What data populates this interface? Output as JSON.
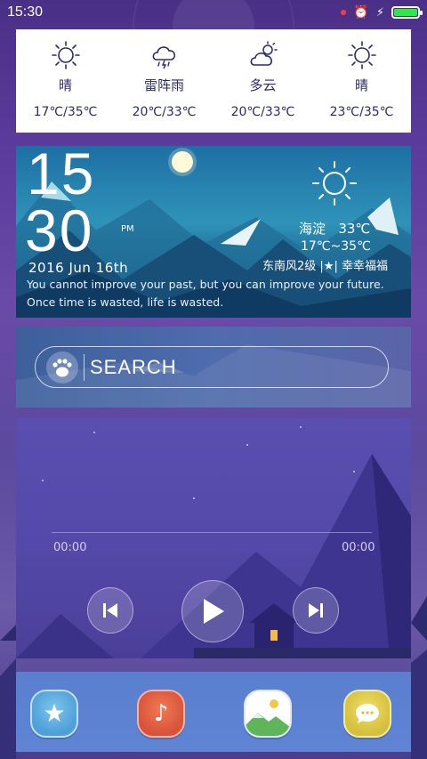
{
  "status_bar": {
    "time": "15:30",
    "battery_level": 1.0
  },
  "forecast": {
    "days": [
      {
        "icon": "sun-icon",
        "condition": "晴",
        "temp": "17℃/35℃"
      },
      {
        "icon": "thunder-rain-icon",
        "condition": "雷阵雨",
        "temp": "20℃/33℃"
      },
      {
        "icon": "partly-cloudy-icon",
        "condition": "多云",
        "temp": "20℃/33℃"
      },
      {
        "icon": "sun-icon",
        "condition": "晴",
        "temp": "23℃/35℃"
      }
    ]
  },
  "clock": {
    "hour": "15",
    "minute": "30",
    "ampm": "PM",
    "date": "2016 Jun 16th",
    "quote_line1": "You cannot improve your past, but you can improve your future.",
    "quote_line2": "Once time is wasted, life is wasted."
  },
  "current_weather": {
    "location": "海淀",
    "temp": "33℃",
    "range": "17℃~35℃",
    "wind": "东南风2级 |★| 幸幸福福"
  },
  "search": {
    "placeholder": "SEARCH"
  },
  "music": {
    "elapsed": "00:00",
    "duration": "00:00",
    "progress": 0
  },
  "dock": {
    "apps": [
      "favorites",
      "music",
      "gallery",
      "messages"
    ]
  },
  "colors": {
    "background": "#5a3a9a",
    "forecast_text": "#2b2a6a",
    "battery": "#2ee84a"
  }
}
